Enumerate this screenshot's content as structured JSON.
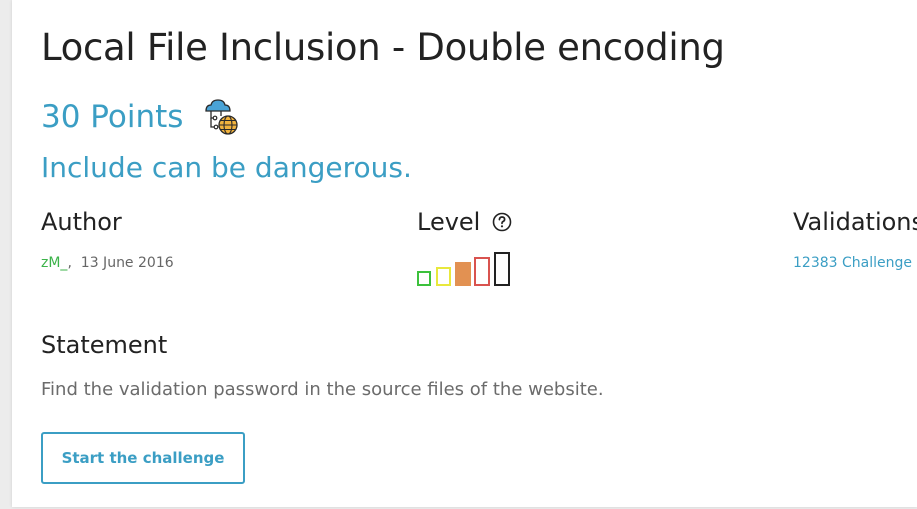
{
  "challenge": {
    "title": "Local File Inclusion - Double encoding",
    "points": "30 Points",
    "category_icon": "cloud-network-globe-icon",
    "subtitle": "Include can be dangerous."
  },
  "meta": {
    "author_label": "Author",
    "author_name": "zM_",
    "author_separator": ",",
    "date": "13 June 2016",
    "level_label": "Level",
    "help_icon": "question-circle-icon",
    "level": {
      "current": 3,
      "max": 5,
      "colors": [
        "#3cc13c",
        "#e8e83c",
        "#e29152",
        "#d9534f",
        "#222222"
      ]
    },
    "validations_label": "Validations",
    "validations_text": "12383 Challenge"
  },
  "statement": {
    "heading": "Statement",
    "text": "Find the validation password in the source files of the website."
  },
  "actions": {
    "start_label": "Start the challenge"
  },
  "colors": {
    "accent": "#3b9ec4",
    "author": "#3cb34a"
  }
}
